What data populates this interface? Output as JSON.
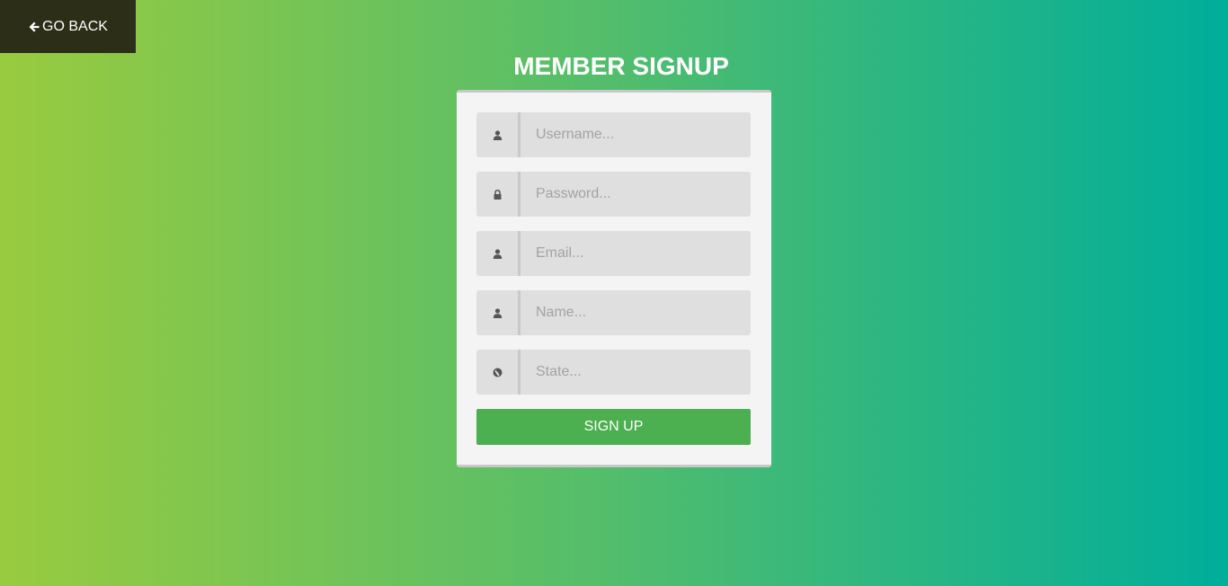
{
  "nav": {
    "go_back_label": "GO BACK",
    "go_back_icon": "arrow-left-icon"
  },
  "form": {
    "title": "MEMBER SIGNUP",
    "fields": [
      {
        "icon": "user-icon",
        "placeholder": "Username...",
        "value": ""
      },
      {
        "icon": "lock-icon",
        "placeholder": "Password...",
        "value": ""
      },
      {
        "icon": "user-icon",
        "placeholder": "Email...",
        "value": ""
      },
      {
        "icon": "user-icon",
        "placeholder": "Name...",
        "value": ""
      },
      {
        "icon": "globe-icon",
        "placeholder": "State...",
        "value": ""
      }
    ],
    "submit_label": "SIGN UP"
  },
  "colors": {
    "gradient_start": "#99cb3f",
    "gradient_end": "#00ae9a",
    "go_back_bg": "#2c2e17",
    "button": "#4caf50",
    "panel": "#f4f4f4",
    "field": "#dfdfdf"
  }
}
